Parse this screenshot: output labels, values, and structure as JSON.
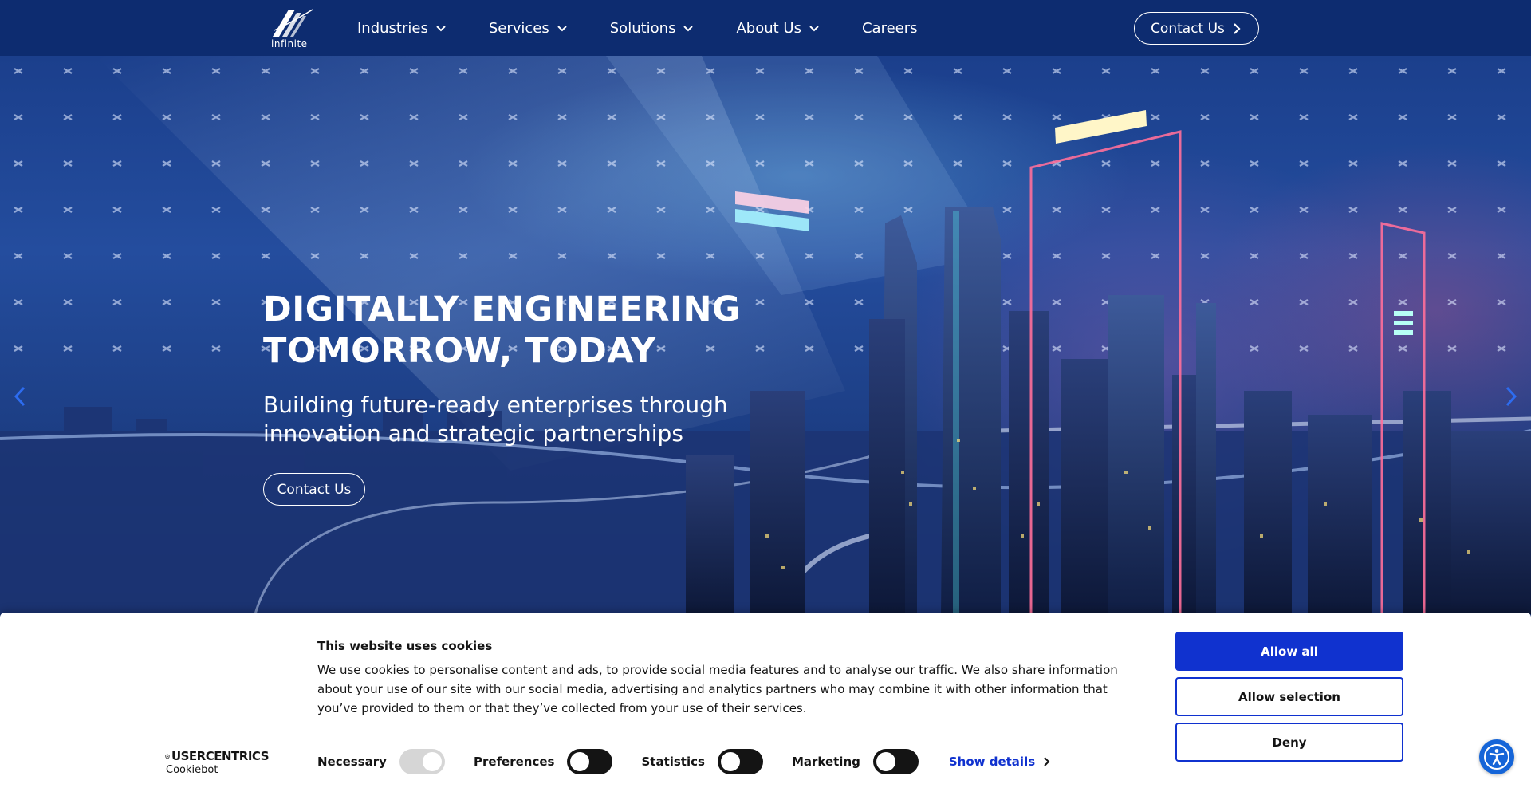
{
  "header": {
    "logo_text": "infinite",
    "nav": [
      {
        "label": "Industries",
        "has_dropdown": true
      },
      {
        "label": "Services",
        "has_dropdown": true
      },
      {
        "label": "Solutions",
        "has_dropdown": true
      },
      {
        "label": "About Us",
        "has_dropdown": true
      },
      {
        "label": "Careers",
        "has_dropdown": false
      }
    ],
    "cta_label": "Contact Us"
  },
  "hero": {
    "title_line1": "DIGITALLY ENGINEERING",
    "title_line2": "TOMORROW, TODAY",
    "subtitle_line1": "Building future-ready enterprises through",
    "subtitle_line2": "innovation and strategic partnerships",
    "cta_label": "Contact Us"
  },
  "cookie_banner": {
    "title": "This website uses cookies",
    "text": "We use cookies to personalise content and ads, to provide social media features and to analyse our traffic. We also share information about your use of our site with our social media, advertising and analytics partners who may combine it with other information that you’ve provided to them or that they’ve collected from your use of their services.",
    "brand_top": "USERCENTRICS",
    "brand_bottom": "Cookiebot",
    "consents": [
      {
        "label": "Necessary",
        "state": "on-disabled"
      },
      {
        "label": "Preferences",
        "state": "off"
      },
      {
        "label": "Statistics",
        "state": "off"
      },
      {
        "label": "Marketing",
        "state": "off"
      }
    ],
    "show_details": "Show details",
    "buttons": {
      "allow_all": "Allow all",
      "allow_selection": "Allow selection",
      "deny": "Deny"
    }
  },
  "colors": {
    "header_bg": "#0d2c70",
    "cookie_accent": "#1032cf",
    "accessibility_button": "#1565d8"
  },
  "icons": {
    "nav_dropdown": "chevron-down-icon",
    "cta": "chevron-right-icon",
    "carousel_prev": "chevron-left-icon",
    "carousel_next": "chevron-right-icon",
    "accessibility": "accessibility-icon",
    "brand": "shield-icon"
  }
}
